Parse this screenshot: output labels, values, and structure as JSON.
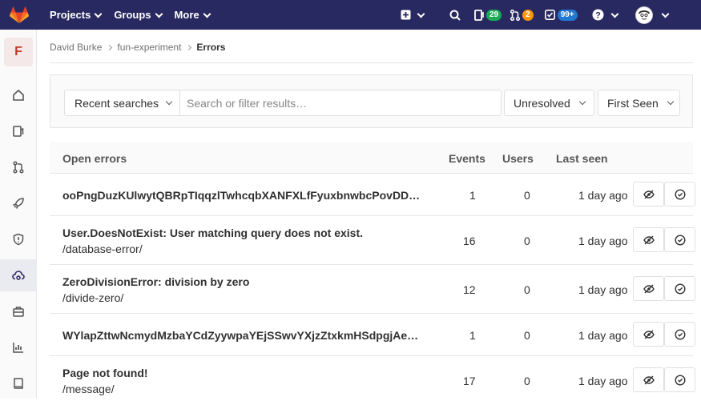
{
  "nav": {
    "projects": "Projects",
    "groups": "Groups",
    "more": "More",
    "issues_count": "29",
    "mr_count": "2",
    "todos_count": "99+"
  },
  "sidebar": {
    "project_letter": "F"
  },
  "breadcrumb": {
    "owner": "David Burke",
    "project": "fun-experiment",
    "current": "Errors"
  },
  "filters": {
    "recent": "Recent searches",
    "search_placeholder": "Search or filter results…",
    "status": "Unresolved",
    "sort": "First Seen"
  },
  "table": {
    "headers": {
      "open": "Open errors",
      "events": "Events",
      "users": "Users",
      "last_seen": "Last seen"
    },
    "rows": [
      {
        "title": "ooPngDuzKUlwytQBRpTIqqzlTwhcqbXANFXLfFyuxbnwbcPovDD…",
        "path": "",
        "events": "1",
        "users": "0",
        "last_seen": "1 day ago"
      },
      {
        "title": "User.DoesNotExist: User matching query does not exist.",
        "path": "/database-error/",
        "events": "16",
        "users": "0",
        "last_seen": "1 day ago"
      },
      {
        "title": "ZeroDivisionError: division by zero",
        "path": "/divide-zero/",
        "events": "12",
        "users": "0",
        "last_seen": "1 day ago"
      },
      {
        "title": "WYlapZttwNcmydMzbaYCdZyywpaYEjSSwvYXjzZtxkmHSdpgjAe…",
        "path": "",
        "events": "1",
        "users": "0",
        "last_seen": "1 day ago"
      },
      {
        "title": "Page not found!",
        "path": "/message/",
        "events": "17",
        "users": "0",
        "last_seen": "1 day ago"
      }
    ]
  },
  "colors": {
    "navbar": "#292961",
    "accent": "#fc6d26",
    "success": "#1aaa55"
  }
}
